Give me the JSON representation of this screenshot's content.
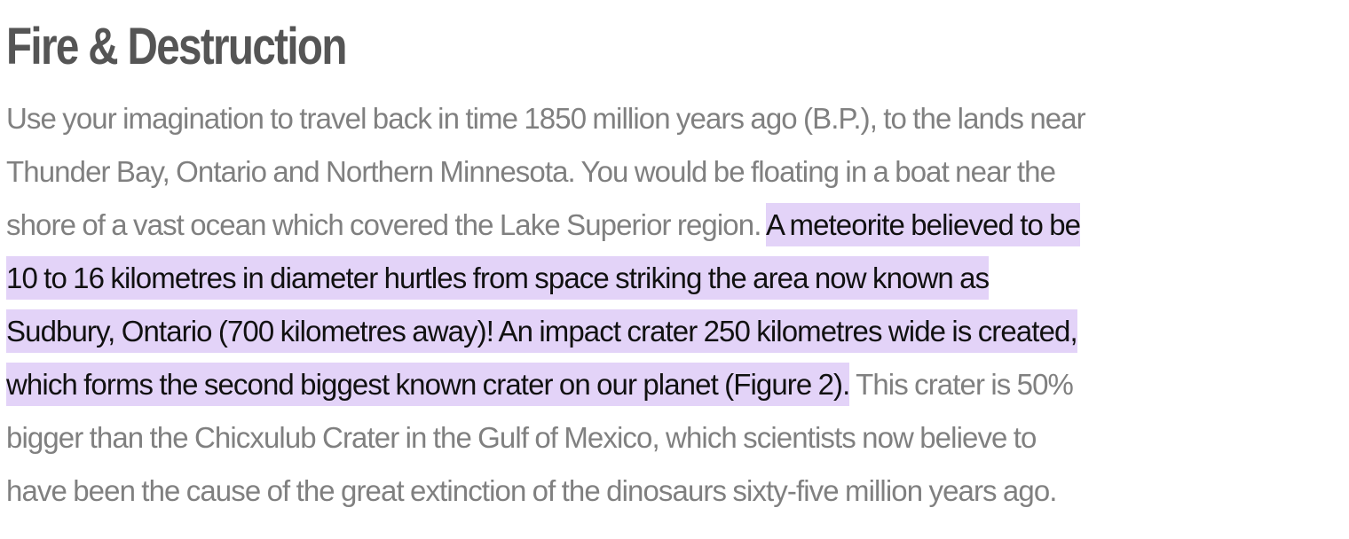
{
  "heading": "Fire & Destruction",
  "paragraph": {
    "lines": [
      {
        "plain": "Use your imagination to travel back in time 1850 million years ago (B.P.), to the lands near",
        "highlighted": "",
        "after": ""
      },
      {
        "plain": "Thunder Bay, Ontario and Northern Minnesota. You would be floating in a boat near the",
        "highlighted": "",
        "after": ""
      },
      {
        "plain": "shore of a vast ocean which covered the Lake Superior region. ",
        "highlighted": "A meteorite believed to be",
        "after": ""
      },
      {
        "plain": "",
        "highlighted": "10 to 16 kilometres in diameter hurtles from space striking the area now known as",
        "after": ""
      },
      {
        "plain": "",
        "highlighted": "Sudbury, Ontario (700 kilometres away)! An impact crater 250 kilometres wide is created,",
        "after": ""
      },
      {
        "plain": "",
        "highlighted": "which forms the second biggest known crater on our planet (Figure 2).",
        "after": " This crater is 50%"
      },
      {
        "plain": "bigger than the Chicxulub Crater in the Gulf of Mexico, which scientists now believe to",
        "highlighted": "",
        "after": ""
      },
      {
        "plain": "have been the cause of the great extinction of the dinosaurs sixty-five million years ago.",
        "highlighted": "",
        "after": ""
      }
    ]
  },
  "colors": {
    "heading": "#555555",
    "body_text": "#808080",
    "highlight_background": "#e3d3f8",
    "highlight_text": "#111111"
  }
}
